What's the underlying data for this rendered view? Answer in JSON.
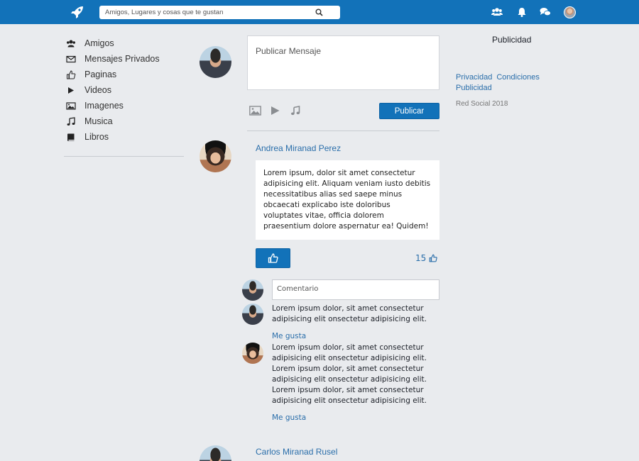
{
  "topbar": {
    "search_placeholder": "Amigos, Lugares y cosas que te gustan",
    "icons": [
      "rocket-icon",
      "search-icon",
      "friends-icon",
      "bell-icon",
      "chat-icon",
      "user-avatar"
    ],
    "color": "#1272b9"
  },
  "sidebar": {
    "items": [
      {
        "label": "Amigos",
        "icon": "friends-icon"
      },
      {
        "label": "Mensajes Privados",
        "icon": "envelope-icon"
      },
      {
        "label": "Paginas",
        "icon": "thumbs-up-icon"
      },
      {
        "label": "Videos",
        "icon": "play-icon"
      },
      {
        "label": "Imagenes",
        "icon": "image-icon"
      },
      {
        "label": "Musica",
        "icon": "music-icon"
      },
      {
        "label": "Libros",
        "icon": "book-icon"
      }
    ]
  },
  "composer": {
    "placeholder": "Publicar Mensaje",
    "publish_label": "Publicar"
  },
  "posts": [
    {
      "author": "Andrea Miranad Perez",
      "body": "Lorem ipsum, dolor sit amet consectetur adipisicing elit. Aliquam veniam iusto debitis necessitatibus alias sed saepe minus obcaecati explicabo iste doloribus voluptates vitae, officia dolorem praesentium dolore aspernatur ea! Quidem!",
      "likes": "15",
      "comment_placeholder": "Comentario",
      "comments": [
        {
          "text": "Lorem ipsum dolor, sit amet consectetur adipisicing elit onsectetur adipisicing elit.",
          "like_label": "Me gusta"
        },
        {
          "text": "Lorem ipsum dolor, sit amet consectetur adipisicing elit onsectetur adipisicing elit. Lorem ipsum dolor, sit amet consectetur adipisicing elit onsectetur adipisicing elit. Lorem ipsum dolor, sit amet consectetur adipisicing elit onsectetur adipisicing elit.",
          "like_label": "Me gusta"
        }
      ]
    },
    {
      "author": "Carlos Miranad Rusel"
    }
  ],
  "right": {
    "ad_title": "Publicidad",
    "links": [
      "Privacidad",
      "Condiciones",
      "Publicidad"
    ],
    "copyright": "Red Social 2018"
  }
}
